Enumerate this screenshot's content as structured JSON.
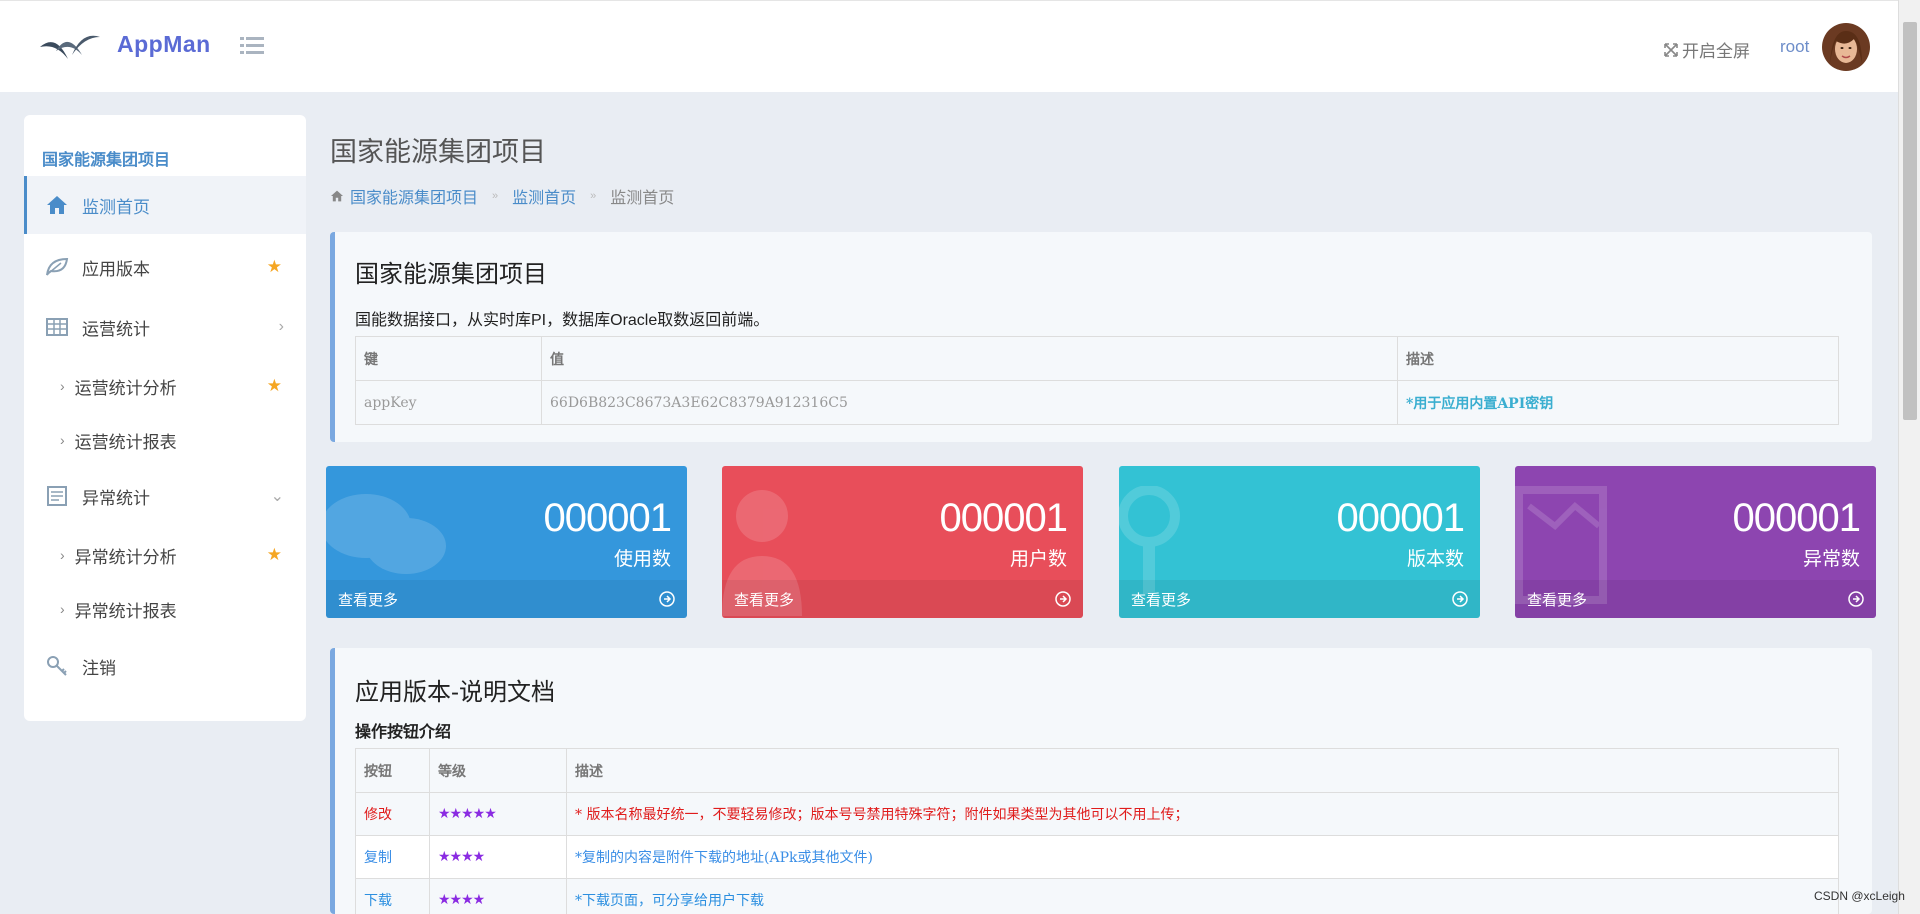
{
  "header": {
    "logo_text": "AppMan",
    "fullscreen_label": "开启全屏",
    "username": "root"
  },
  "sidebar": {
    "title": "国家能源集团项目",
    "items": [
      {
        "label": "监测首页",
        "icon": "home-icon"
      },
      {
        "label": "应用版本",
        "icon": "leaf-icon",
        "starred": true
      },
      {
        "label": "运营统计",
        "icon": "table-icon"
      },
      {
        "label": "运营统计分析",
        "starred": true
      },
      {
        "label": "运营统计报表"
      },
      {
        "label": "异常统计",
        "icon": "list-icon"
      },
      {
        "label": "异常统计分析",
        "starred": true
      },
      {
        "label": "异常统计报表"
      },
      {
        "label": "注销",
        "icon": "key-icon"
      }
    ]
  },
  "page": {
    "title": "国家能源集团项目",
    "breadcrumb": [
      "国家能源集团项目",
      "监测首页",
      "监测首页"
    ]
  },
  "project_panel": {
    "title": "国家能源集团项目",
    "description": "国能数据接口，从实时库PI，数据库Oracle取数返回前端。",
    "table": {
      "headers": [
        "键",
        "值",
        "描述"
      ],
      "rows": [
        [
          "appKey",
          "66D6B823C8673A3E62C8379A912316C5",
          "*用于应用内置API密钥"
        ]
      ]
    }
  },
  "tiles": [
    {
      "value": "000001",
      "label": "使用数",
      "more": "查看更多",
      "color": "#3497dc"
    },
    {
      "value": "000001",
      "label": "用户数",
      "more": "查看更多",
      "color": "#e84e5a"
    },
    {
      "value": "000001",
      "label": "版本数",
      "more": "查看更多",
      "color": "#33c2d4"
    },
    {
      "value": "000001",
      "label": "异常数",
      "more": "查看更多",
      "color": "#8d45b0"
    }
  ],
  "doc_panel": {
    "title": "应用版本-说明文档",
    "subtitle": "操作按钮介绍",
    "table": {
      "headers": [
        "按钮",
        "等级",
        "描述"
      ],
      "rows": [
        {
          "button": "修改",
          "stars": "★★★★★",
          "desc": "* 版本名称最好统一，不要轻易修改；版本号号禁用特殊字符；附件如果类型为其他可以不用上传；"
        },
        {
          "button": "复制",
          "stars": "★★★★",
          "desc": "*复制的内容是附件下载的地址(APk或其他文件)"
        },
        {
          "button": "下载",
          "stars": "★★★★",
          "desc": "*下载页面，可分享给用户下载"
        }
      ]
    }
  },
  "watermark": "CSDN @xcLeigh"
}
